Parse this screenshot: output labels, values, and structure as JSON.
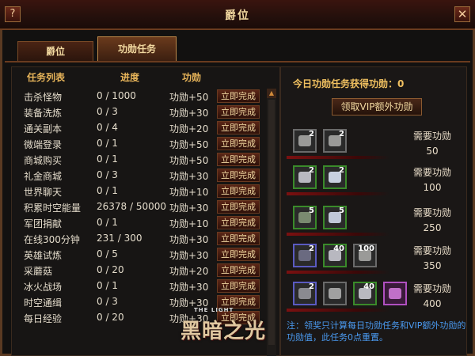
{
  "window": {
    "title": "爵位",
    "help_label": "?",
    "close_label": "✕"
  },
  "tabs": [
    {
      "label": "爵位"
    },
    {
      "label": "功勋任务"
    }
  ],
  "task_list": {
    "headers": {
      "name": "任务列表",
      "progress": "进度",
      "merit": "功勋"
    },
    "rows": [
      {
        "name": "击杀怪物",
        "progress": "0 / 1000",
        "merit": "功勋+50",
        "action": "立即完成"
      },
      {
        "name": "装备洗炼",
        "progress": "0 / 3",
        "merit": "功勋+30",
        "action": "立即完成"
      },
      {
        "name": "通关副本",
        "progress": "0 / 4",
        "merit": "功勋+20",
        "action": "立即完成"
      },
      {
        "name": "微端登录",
        "progress": "0 / 1",
        "merit": "功勋+50",
        "action": "立即完成"
      },
      {
        "name": "商城购买",
        "progress": "0 / 1",
        "merit": "功勋+50",
        "action": "立即完成"
      },
      {
        "name": "礼金商城",
        "progress": "0 / 3",
        "merit": "功勋+30",
        "action": "立即完成"
      },
      {
        "name": "世界聊天",
        "progress": "0 / 1",
        "merit": "功勋+10",
        "action": "立即完成"
      },
      {
        "name": "积累时空能量",
        "progress": "26378 / 50000",
        "merit": "功勋+30",
        "action": "立即完成"
      },
      {
        "name": "军团捐献",
        "progress": "0 / 1",
        "merit": "功勋+10",
        "action": "立即完成"
      },
      {
        "name": "在线300分钟",
        "progress": "231 / 300",
        "merit": "功勋+30",
        "action": "立即完成"
      },
      {
        "name": "英雄试炼",
        "progress": "0 / 5",
        "merit": "功勋+30",
        "action": "立即完成"
      },
      {
        "name": "采蘑菇",
        "progress": "0 / 20",
        "merit": "功勋+20",
        "action": "立即完成"
      },
      {
        "name": "冰火战场",
        "progress": "0 / 1",
        "merit": "功勋+30",
        "action": "立即完成"
      },
      {
        "name": "时空通缉",
        "progress": "0 / 3",
        "merit": "功勋+30",
        "action": "立即完成"
      },
      {
        "name": "每日经验",
        "progress": "0 / 20",
        "merit": "功勋+30",
        "action": "立即完成"
      }
    ]
  },
  "rewards": {
    "today_label": "今日功勋任务获得功勋：0",
    "vip_button": "领取VIP额外功勋",
    "need_label": "需要功勋",
    "tiers": [
      {
        "value": "50",
        "items": [
          {
            "count": "2",
            "rarity": "gray",
            "icon": "stone-icon"
          },
          {
            "count": "2",
            "rarity": "gray",
            "icon": "stone-icon"
          }
        ]
      },
      {
        "value": "100",
        "items": [
          {
            "count": "2",
            "rarity": "green",
            "icon": "feather-icon"
          },
          {
            "count": "2",
            "rarity": "green",
            "icon": "orb-icon"
          }
        ]
      },
      {
        "value": "250",
        "items": [
          {
            "count": "5",
            "rarity": "green",
            "icon": "gem-icon"
          },
          {
            "count": "5",
            "rarity": "green",
            "icon": "crystal-icon"
          }
        ]
      },
      {
        "value": "350",
        "items": [
          {
            "count": "2",
            "rarity": "blue",
            "icon": "shield-icon"
          },
          {
            "count": "40",
            "rarity": "green",
            "icon": "feather-icon"
          },
          {
            "count": "100",
            "rarity": "gray",
            "icon": "stone-icon"
          }
        ]
      },
      {
        "value": "400",
        "items": [
          {
            "count": "2",
            "rarity": "blue",
            "icon": "medal-icon"
          },
          {
            "count": "",
            "rarity": "gray",
            "icon": "sword-icon"
          },
          {
            "count": "40",
            "rarity": "green",
            "icon": "feather-icon"
          },
          {
            "count": "",
            "rarity": "purple",
            "icon": "chest-icon"
          }
        ]
      }
    ],
    "note": "注：领奖只计算每日功勋任务和VIP额外功勋的功勋值，此任务0点重置。"
  },
  "logo": {
    "small": "THE LIGHT",
    "main": "黑暗之光"
  }
}
